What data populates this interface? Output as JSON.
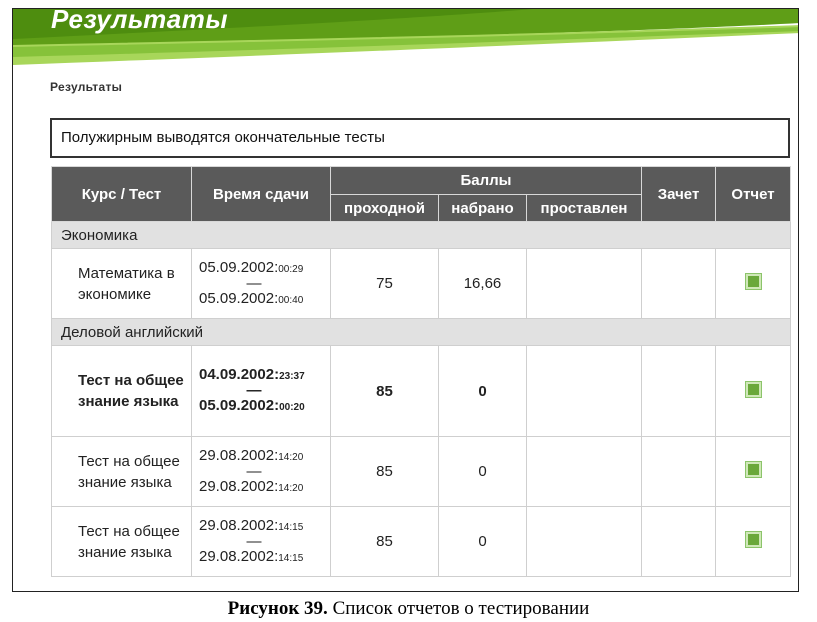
{
  "banner": {
    "title": "Результаты"
  },
  "breadcrumb": "Результаты",
  "notice": "Полужирным выводятся окончательные тесты",
  "table": {
    "headers": {
      "course": "Курс / Тест",
      "time": "Время сдачи",
      "scores": "Баллы",
      "passing": "проходной",
      "earned": "набрано",
      "assigned": "проставлен",
      "credit": "Зачет",
      "report": "Отчет"
    },
    "groups": [
      {
        "name": "Экономика",
        "rows": [
          {
            "test": "Математика в экономике",
            "start_date": "05.09.2002:",
            "start_time": "00:29",
            "sep": "—",
            "end_date": "05.09.2002:",
            "end_time": "00:40",
            "passing": "75",
            "earned": "16,66",
            "assigned": "",
            "credit": "",
            "bold": false
          }
        ]
      },
      {
        "name": "Деловой английский",
        "rows": [
          {
            "test": "Тест на общее знание языка",
            "start_date": "04.09.2002:",
            "start_time": "23:37",
            "sep": "—",
            "end_date": "05.09.2002:",
            "end_time": "00:20",
            "passing": "85",
            "earned": "0",
            "assigned": "",
            "credit": "",
            "bold": true
          },
          {
            "test": "Тест на общее знание языка",
            "start_date": "29.08.2002:",
            "start_time": "14:20",
            "sep": "—",
            "end_date": "29.08.2002:",
            "end_time": "14:20",
            "passing": "85",
            "earned": "0",
            "assigned": "",
            "credit": "",
            "bold": false
          },
          {
            "test": "Тест на общее знание языка",
            "start_date": "29.08.2002:",
            "start_time": "14:15",
            "sep": "—",
            "end_date": "29.08.2002:",
            "end_time": "14:15",
            "passing": "85",
            "earned": "0",
            "assigned": "",
            "credit": "",
            "bold": false
          }
        ]
      }
    ]
  },
  "caption": {
    "label": "Рисунок 39.",
    "text": " Список отчетов о тестировании"
  },
  "colors": {
    "accent_green": "#7dbb2a",
    "header_gray": "#5a5a5a",
    "group_gray": "#e1e1e1",
    "report_icon": "#6aa83a"
  },
  "icons": {
    "report": "report-square-icon"
  }
}
